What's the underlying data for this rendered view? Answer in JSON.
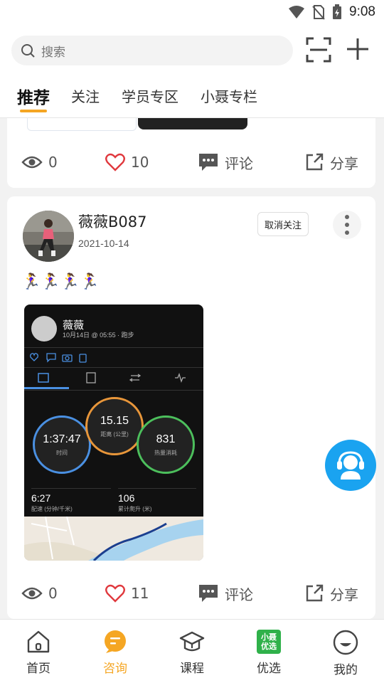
{
  "status_bar": {
    "time": "9:08"
  },
  "search": {
    "placeholder": "搜索"
  },
  "tabs": [
    {
      "label": "推荐",
      "active": true
    },
    {
      "label": "关注"
    },
    {
      "label": "学员专区"
    },
    {
      "label": "小聂专栏"
    }
  ],
  "post_prev": {
    "views": "0",
    "likes": "10",
    "comment_label": "评论",
    "share_label": "分享"
  },
  "post": {
    "author": "薇薇B087",
    "date": "2021-10-14",
    "unfollow_label": "取消关注",
    "text": "🏃‍♀️🏃‍♀️🏃‍♀️🏃‍♀️",
    "views": "0",
    "likes": "11",
    "comment_label": "评论",
    "share_label": "分享",
    "activity": {
      "name": "薇薇",
      "subtitle": "10月14日 @ 05:55 · 跑步",
      "distance": "15.15",
      "distance_label": "距离 (公里)",
      "time": "1:37:47",
      "time_label": "时间",
      "calories": "831",
      "calories_label": "热量消耗",
      "pace": "6:27",
      "pace_label": "配速 (分钟/千米)",
      "elevation": "106",
      "elevation_label": "累计爬升 (米)"
    }
  },
  "bottom_nav": [
    {
      "label": "首页"
    },
    {
      "label": "咨询",
      "active": true
    },
    {
      "label": "课程"
    },
    {
      "label": "优选",
      "badge": [
        "小聂",
        "优选"
      ]
    },
    {
      "label": "我的"
    }
  ],
  "colors": {
    "accent": "#f5a623",
    "like": "#e0393e",
    "service": "#1aa3f0",
    "badge": "#2fb14a"
  }
}
